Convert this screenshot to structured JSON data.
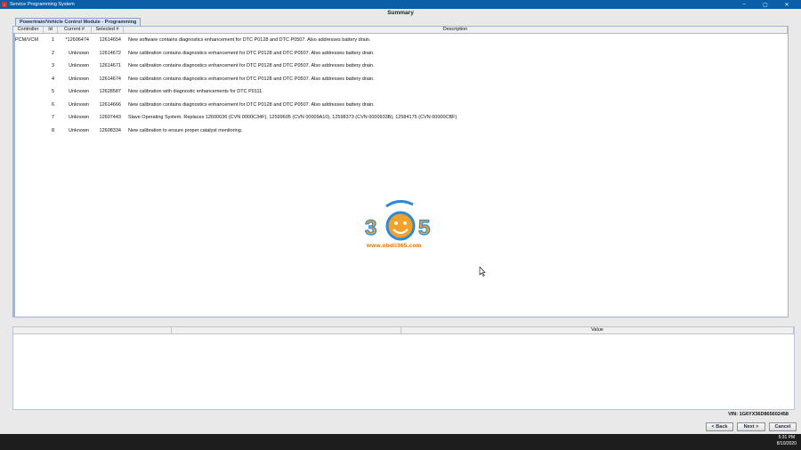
{
  "window": {
    "title": "Service Programming System",
    "controls": [
      "–",
      "▢",
      "✕"
    ]
  },
  "heading": "Summary",
  "tab": {
    "label": "Powertrain/Vehicle Control Module - Programming"
  },
  "table": {
    "columns": [
      "Controller",
      "Id",
      "Current #",
      "Selected #",
      "Description"
    ],
    "rows": [
      {
        "controller": "PCM/VCM",
        "id": "1",
        "current": "*12606474",
        "selected": "12614654",
        "description": "New software contains diagnostics enhancement for DTC P0128 and DTC P0507. Also addresses battery drain."
      },
      {
        "controller": "",
        "id": "2",
        "current": "Unknown",
        "selected": "12614672",
        "description": "New calibration contains diagnostics enhancement for DTC P0128 and DTC P0507. Also addresses battery drain."
      },
      {
        "controller": "",
        "id": "3",
        "current": "Unknown",
        "selected": "12614671",
        "description": "New calibration contains diagnostics enhancement for DTC P0128 and DTC P0507. Also addresses battery drain."
      },
      {
        "controller": "",
        "id": "4",
        "current": "Unknown",
        "selected": "12614674",
        "description": "New calibration contains diagnostics enhancement for DTC P0128 and DTC P0507. Also addresses battery drain."
      },
      {
        "controller": "",
        "id": "5",
        "current": "Unknown",
        "selected": "12628587",
        "description": "New calibration with diagnostic enhancements for DTC P0111."
      },
      {
        "controller": "",
        "id": "6",
        "current": "Unknown",
        "selected": "12614666",
        "description": "New calibration contains diagnostics enhancement for DTC P0128 and DTC P0507. Also addresses battery drain."
      },
      {
        "controller": "",
        "id": "7",
        "current": "Unknown",
        "selected": "12607443",
        "description": "Slave Operating System. Replaces 12600036 (CVN 0000C34F), 12599605 (CVN 00009A10), 12598373 (CVN 0000933B), 12584175 (CVN 00000CBF)"
      },
      {
        "controller": "",
        "id": "8",
        "current": "Unknown",
        "selected": "12608334",
        "description": "New calibration to ensure proper catalyst monitoring."
      }
    ]
  },
  "watermark": {
    "logo_text": "365",
    "url": "www.obdii365.com"
  },
  "detail_table": {
    "columns": [
      "",
      "",
      "Value"
    ]
  },
  "vin": "VIN: 1G6YX36D865602458",
  "buttons": {
    "back": "< Back",
    "next": "Next >",
    "cancel": "Cancel"
  },
  "clock": {
    "time": "5:31 PM",
    "date": "8/10/2020"
  },
  "colors": {
    "titlebar": "#0b5ea8",
    "watermark_orange": "#e06e14",
    "watermark_blue": "#2f8ad6"
  }
}
